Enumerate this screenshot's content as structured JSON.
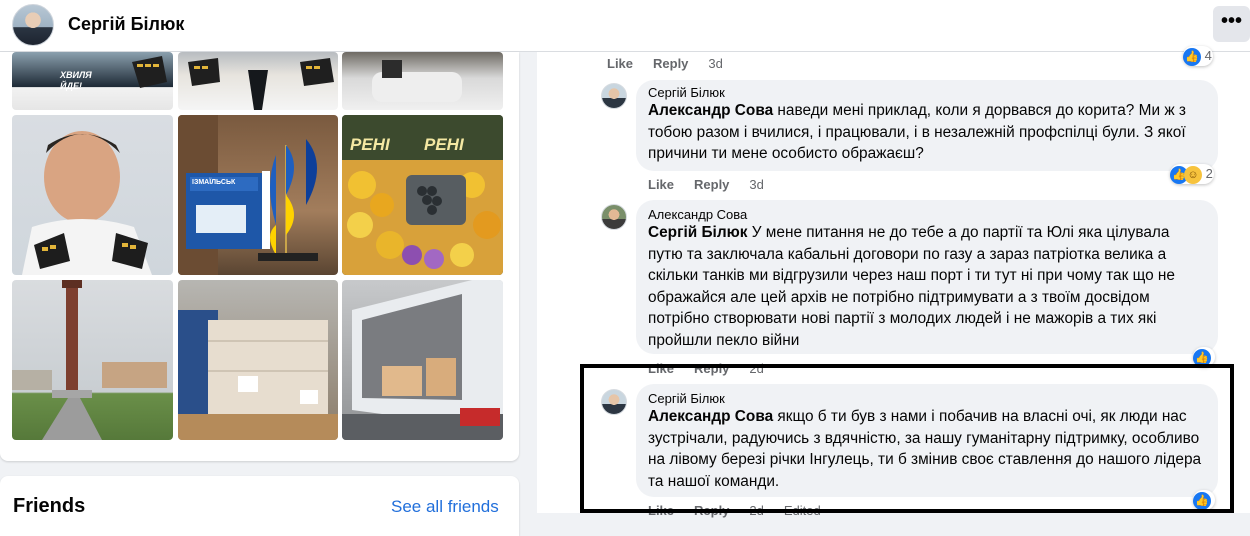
{
  "header": {
    "name": "Сергій Білюк",
    "more_label": "•••"
  },
  "photos": {
    "tile_texts": [
      "ХВИЛЯ ЙДЕ!",
      "ІЗМАЇЛЬСЬК",
      "РЕНІ",
      "РЕНІ"
    ]
  },
  "friends": {
    "title": "Friends",
    "see_all": "See all friends"
  },
  "feed": {
    "top_actions": {
      "like": "Like",
      "reply": "Reply",
      "time": "3d",
      "reaction_count": "4"
    },
    "comments": [
      {
        "author": "Сергій Білюк",
        "mention": "Александр Сова",
        "text": " наведи мені приклад, коли я дорвався до корита? Ми ж з тобою разом і вчилися, і працювали, і в незалежній профспілці були. З якої причини ти мене особисто ображаєш?",
        "like": "Like",
        "reply": "Reply",
        "time": "3d",
        "reaction_count": "2"
      },
      {
        "author": "Александр Сова",
        "mention": "Сергій Білюк",
        "text": " У мене питання не до тебе а до партії та Юлі яка цілувала путю та заключала кабальні договори по газу а зараз патріотка велика а скільки танків ми відгрузили через наш порт і ти тут ні при чому так що не ображайся але цей архів не потрібно підтримувати а з твоїм досвідом потрібно створювати нові партії з молодих людей і не мажорів а тих які пройшли пекло війни",
        "like": "Like",
        "reply": "Reply",
        "time": "2d"
      },
      {
        "author": "Сергій Білюк",
        "mention": "Александр Сова",
        "text": " якщо б ти був з нами і побачив на власні очі, як люди нас зустрічали, радуючись з вдячністю, за нашу гуманітарну підтримку, особливо на лівому березі річки Інгулець, ти б змінив своє ставлення до нашого лідера та нашої команди.",
        "like": "Like",
        "reply": "Reply",
        "time": "2d",
        "edited": "Edited"
      }
    ]
  },
  "colors": {
    "accent": "#1877f2",
    "link": "#216fdb",
    "muted": "#65676b",
    "bubble": "#f0f2f5"
  }
}
